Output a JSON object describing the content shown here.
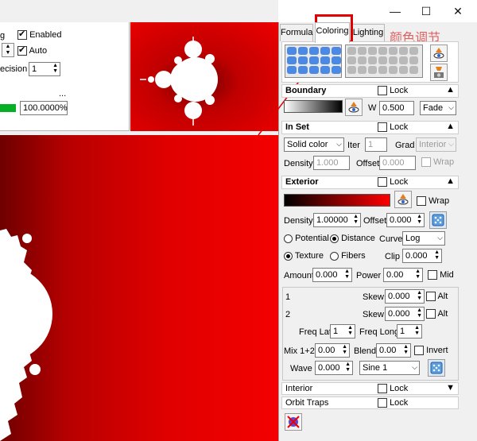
{
  "window": {
    "minimize": "—",
    "maximize": "☐",
    "close": "✕"
  },
  "top_controls": {
    "enabled_label": "Enabled",
    "auto_label": "Auto",
    "precision_label": "ecision",
    "precision_value": "1",
    "ellipsis": "...",
    "progress_value": "100.0000%",
    "progress_fraction": 1.0
  },
  "tabs": [
    {
      "label": "Formula"
    },
    {
      "label": "Coloring"
    },
    {
      "label": "Lighting"
    }
  ],
  "annotation_text": "颜色调节",
  "boundary": {
    "title": "Boundary",
    "lock_label": "Lock",
    "w_label": "W",
    "w_value": "0.500",
    "mode": "Fade"
  },
  "in_set": {
    "title": "In Set",
    "lock_label": "Lock",
    "method": "Solid color",
    "iter_label": "Iter",
    "iter_value": "1",
    "grad_label": "Grad",
    "grad_value": "Interior",
    "density_label": "Density",
    "density_value": "1.000",
    "offset_label": "Offset",
    "offset_value": "0.000",
    "wrap_label": "Wrap"
  },
  "exterior": {
    "title": "Exterior",
    "lock_label": "Lock",
    "wrap_label": "Wrap",
    "density_label": "Density",
    "density_value": "1.00000",
    "offset_label": "Offset",
    "offset_value": "0.000",
    "potential_label": "Potential",
    "distance_label": "Distance",
    "curve_label": "Curve",
    "curve_value": "Log",
    "texture_label": "Texture",
    "fibers_label": "Fibers",
    "clip_label": "Clip",
    "clip_value": "0.000",
    "amount_label": "Amount",
    "amount_value": "0.000",
    "power_label": "Power",
    "power_value": "0.00",
    "mid_label": "Mid",
    "row1_label": "1",
    "skew_label": "Skew",
    "skew1_value": "0.000",
    "alt_label": "Alt",
    "row2_label": "2",
    "skew2_value": "0.000",
    "freq_lat_label": "Freq Lat",
    "freq_lat_value": "1",
    "freq_long_label": "Freq Long",
    "freq_long_value": "1",
    "mix_label": "Mix 1+2",
    "mix_value": "0.00",
    "blend_label": "Blend",
    "blend_value": "0.00",
    "invert_label": "Invert",
    "wave_label": "Wave",
    "wave_value": "0.000",
    "wave_type": "Sine 1"
  },
  "interior": {
    "title": "Interior",
    "lock_label": "Lock"
  },
  "orbit_traps": {
    "title": "Orbit Traps",
    "lock_label": "Lock"
  },
  "colors": {
    "fractal_red": "#e10000",
    "highlight_box": "#e00000",
    "annotation": "#e06060"
  }
}
